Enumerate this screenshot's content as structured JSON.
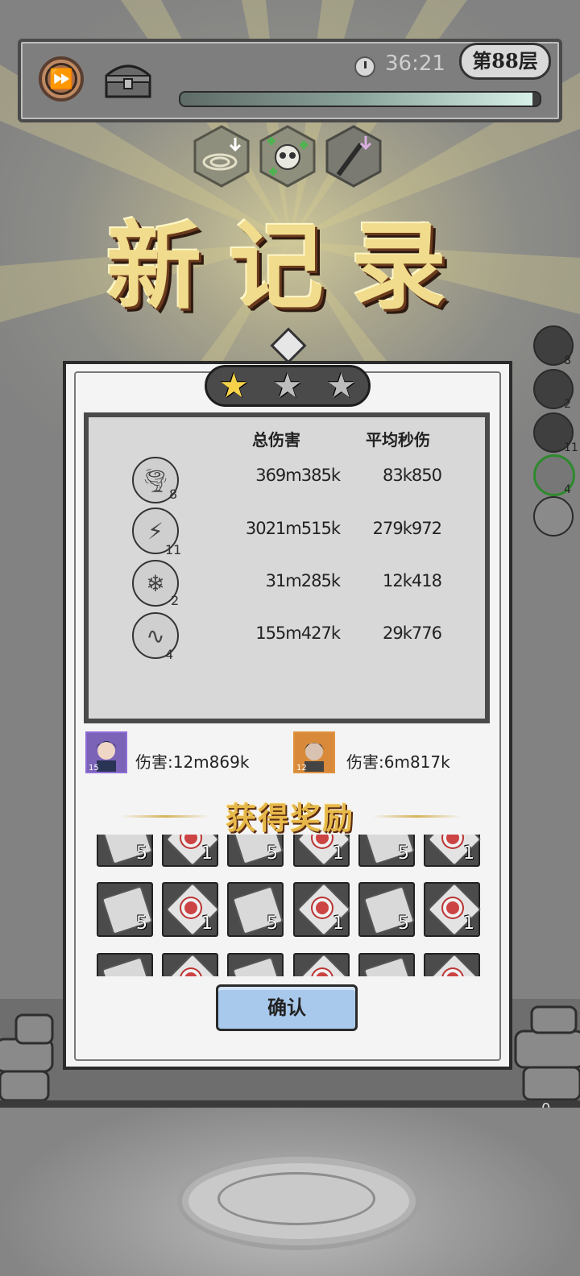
{
  "top_bar": {
    "timer": "36:21",
    "floor": "第88层",
    "progress_fraction": 0.98
  },
  "buffs": [
    {
      "icon": "spiral-down-icon"
    },
    {
      "icon": "skull-plus-icon"
    },
    {
      "icon": "blade-down-icon"
    }
  ],
  "title": "新记录",
  "side_skills": [
    {
      "icon": "skill-icon",
      "level": "8"
    },
    {
      "icon": "skill-icon",
      "level": "2"
    },
    {
      "icon": "skill-icon",
      "level": "11"
    },
    {
      "icon": "skill-icon",
      "level": "4"
    },
    {
      "icon": "empty-slot-icon",
      "level": ""
    }
  ],
  "result": {
    "stars_earned": 1,
    "stars_total": 3,
    "headers": {
      "total": "总伤害",
      "dps": "平均秒伤"
    },
    "rows": [
      {
        "icon": "tornado-icon",
        "level": "8",
        "total": "369m385k",
        "dps": "83k850"
      },
      {
        "icon": "lightning-icon",
        "level": "11",
        "total": "3021m515k",
        "dps": "279k972"
      },
      {
        "icon": "crystal-icon",
        "level": "2",
        "total": "31m285k",
        "dps": "12k418"
      },
      {
        "icon": "drill-icon",
        "level": "4",
        "total": "155m427k",
        "dps": "29k776"
      }
    ],
    "heroes": [
      {
        "level": "15",
        "damage": "伤害:12m869k",
        "frame_color": "#8e6bd6"
      },
      {
        "level": "12",
        "damage": "伤害:6m817k",
        "frame_color": "#e0923f"
      }
    ],
    "reward_title": "获得奖励",
    "rewards": [
      {
        "type": "scroll-stone",
        "count": "5"
      },
      {
        "type": "sun-gem",
        "count": "1"
      },
      {
        "type": "scroll-stone",
        "count": "5"
      },
      {
        "type": "sun-gem",
        "count": "1"
      },
      {
        "type": "scroll-stone",
        "count": "5"
      },
      {
        "type": "sun-gem",
        "count": "1"
      },
      {
        "type": "scroll-stone",
        "count": "5"
      },
      {
        "type": "sun-gem",
        "count": "1"
      },
      {
        "type": "scroll-stone",
        "count": "5"
      },
      {
        "type": "sun-gem",
        "count": "1"
      },
      {
        "type": "scroll-stone",
        "count": "5"
      },
      {
        "type": "sun-gem",
        "count": "1"
      },
      {
        "type": "scroll-stone",
        "count": ""
      },
      {
        "type": "sun-gem",
        "count": ""
      },
      {
        "type": "scroll-stone",
        "count": ""
      },
      {
        "type": "sun-gem",
        "count": ""
      },
      {
        "type": "scroll-stone",
        "count": ""
      },
      {
        "type": "sun-gem",
        "count": ""
      }
    ],
    "confirm_label": "确认"
  },
  "bottom_counter": "0"
}
